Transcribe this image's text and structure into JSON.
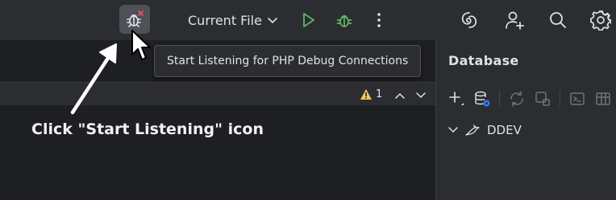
{
  "toolbar": {
    "run_config": "Current File",
    "icons": {
      "listen": "start-listening-php-debug-icon",
      "run": "run-icon",
      "debug": "debug-icon",
      "more": "more-vertical-icon",
      "ai": "ai-assistant-icon",
      "user": "add-user-icon",
      "search": "search-icon",
      "settings": "gear-icon"
    }
  },
  "tooltip": {
    "text": "Start Listening for PHP Debug Connections"
  },
  "editor": {
    "warning_count": "1"
  },
  "database": {
    "title": "Database",
    "tree": [
      {
        "label": "DDEV"
      }
    ]
  },
  "annotation": {
    "text": "Click \"Start Listening\" icon"
  },
  "colors": {
    "toolbar_bg": "#2b2d30",
    "editor_bg": "#1e1f22",
    "run_green": "#5fb865",
    "debug_green": "#5fb865",
    "stop_red": "#e55765",
    "warning_yellow": "#f2c55c"
  }
}
